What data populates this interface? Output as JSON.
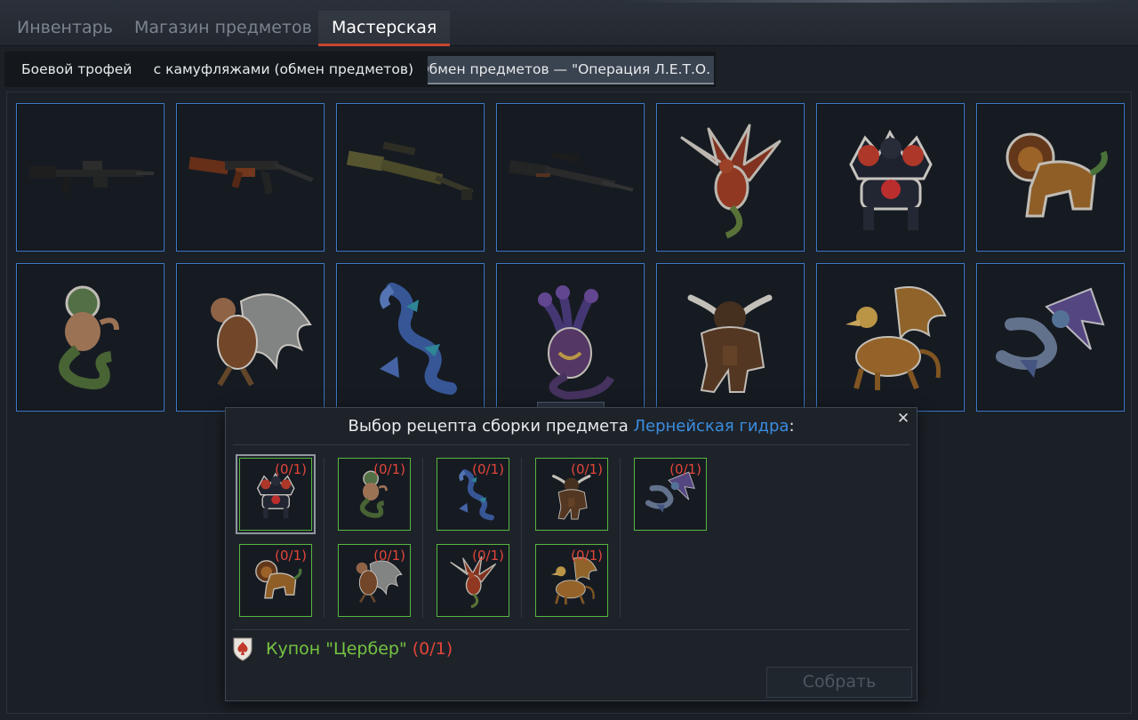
{
  "main_tabs": [
    {
      "label": "Инвентарь",
      "active": false
    },
    {
      "label": "Магазин предметов",
      "active": false
    },
    {
      "label": "Мастерская",
      "active": true
    }
  ],
  "sub_tabs": [
    {
      "label": "Боевой трофей",
      "active": false
    },
    {
      "label": "Наборы с камуфляжами (обмен предметов)",
      "active": false
    },
    {
      "label": "Обмен предметов — \"Операция Л.Е.Т.О.",
      "active": true
    }
  ],
  "grid_items": [
    {
      "icon": "machine-gun-dark-icon"
    },
    {
      "icon": "ak-rifle-icon"
    },
    {
      "icon": "scoped-rifle-camo-icon"
    },
    {
      "icon": "sniper-rifle-dark-icon"
    },
    {
      "icon": "red-dragon-icon"
    },
    {
      "icon": "cerberus-icon"
    },
    {
      "icon": "lion-chimera-icon"
    },
    {
      "icon": "medusa-icon"
    },
    {
      "icon": "harpy-icon"
    },
    {
      "icon": "sea-serpent-icon"
    },
    {
      "icon": "hydra-icon"
    },
    {
      "icon": "minotaur-icon"
    },
    {
      "icon": "griffin-icon"
    },
    {
      "icon": "wyvern-icon"
    }
  ],
  "dialog": {
    "title_prefix": "Выбор рецепта сборки предмета",
    "item_name": "Лернейская гидра",
    "title_suffix": ":",
    "close_icon": "close-icon",
    "recipes": [
      {
        "icon": "cerberus-icon",
        "count": "(0/1)",
        "selected": true
      },
      {
        "icon": "medusa-icon",
        "count": "(0/1)",
        "selected": false
      },
      {
        "icon": "sea-serpent-icon",
        "count": "(0/1)",
        "selected": false
      },
      {
        "icon": "minotaur-icon",
        "count": "(0/1)",
        "selected": false
      },
      {
        "icon": "wyvern-icon",
        "count": "(0/1)",
        "selected": false
      },
      {
        "icon": "lion-chimera-icon",
        "count": "(0/1)",
        "selected": false
      },
      {
        "icon": "harpy-icon",
        "count": "(0/1)",
        "selected": false
      },
      {
        "icon": "red-dragon-icon",
        "count": "(0/1)",
        "selected": false
      },
      {
        "icon": "griffin-icon",
        "count": "(0/1)",
        "selected": false
      }
    ],
    "coupon": {
      "icon": "spade-shield-icon",
      "label": "Купон \"Цербер\"",
      "count": "(0/1)"
    },
    "build_button": "Собрать"
  },
  "colors": {
    "accent_tab": "#c9452f",
    "cell_border": "#3d79c7",
    "recipe_border": "#58b640",
    "highlight": "#3b8de0",
    "missing_count": "#e2453a",
    "coupon_text": "#76c442"
  }
}
